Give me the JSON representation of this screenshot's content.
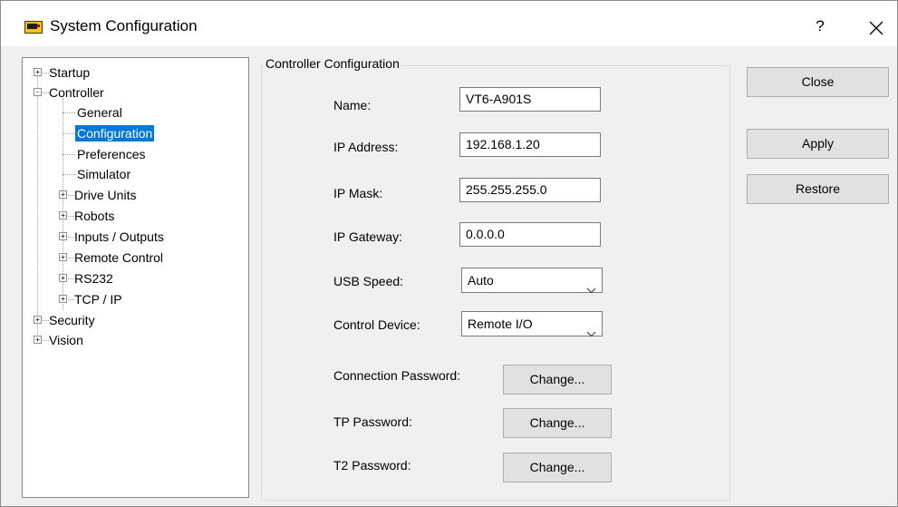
{
  "window": {
    "title": "System Configuration",
    "help_label": "?",
    "app_icon": "controller-app-icon"
  },
  "tree": {
    "items": [
      {
        "label": "Startup",
        "expander": "+"
      },
      {
        "label": "Controller",
        "expander": "-"
      },
      {
        "label": "General"
      },
      {
        "label": "Configuration",
        "selected": true
      },
      {
        "label": "Preferences"
      },
      {
        "label": "Simulator"
      },
      {
        "label": "Drive Units",
        "expander": "+"
      },
      {
        "label": "Robots",
        "expander": "+"
      },
      {
        "label": "Inputs / Outputs",
        "expander": "+"
      },
      {
        "label": "Remote Control",
        "expander": "+"
      },
      {
        "label": "RS232",
        "expander": "+"
      },
      {
        "label": "TCP / IP",
        "expander": "+"
      },
      {
        "label": "Security",
        "expander": "+"
      },
      {
        "label": "Vision",
        "expander": "+"
      }
    ],
    "selection_color": "#0078d7"
  },
  "config": {
    "group_title": "Controller Configuration",
    "name_label": "Name:",
    "name_value": "VT6-A901S",
    "ip_address_label": "IP Address:",
    "ip_address_value": "192.168.1.20",
    "ip_mask_label": "IP Mask:",
    "ip_mask_value": "255.255.255.0",
    "ip_gateway_label": "IP Gateway:",
    "ip_gateway_value": "0.0.0.0",
    "usb_speed_label": "USB Speed:",
    "usb_speed_value": "Auto",
    "control_device_label": "Control Device:",
    "control_device_value": "Remote I/O",
    "connection_password_label": "Connection Password:",
    "tp_password_label": "TP Password:",
    "t2_password_label": "T2 Password:",
    "change_label": "Change..."
  },
  "actions": {
    "close_label": "Close",
    "apply_label": "Apply",
    "restore_label": "Restore"
  }
}
